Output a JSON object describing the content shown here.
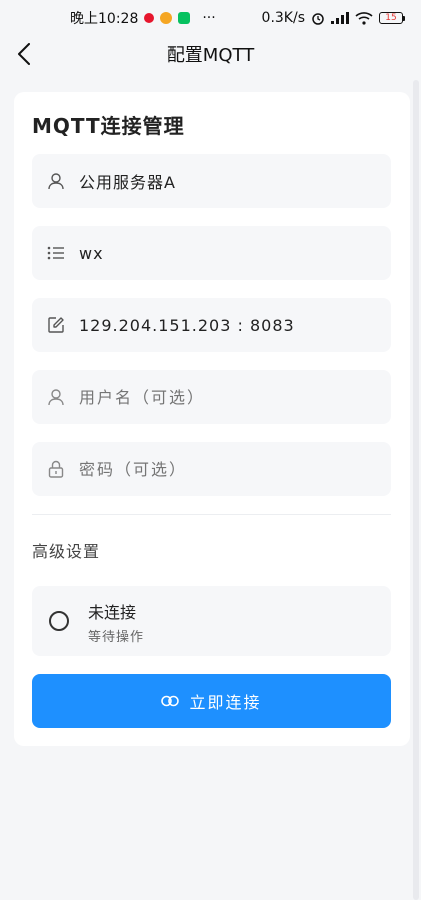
{
  "status_bar": {
    "time": "晚上10:28",
    "dots": "···",
    "net_speed": "0.3K/s",
    "battery": "15"
  },
  "header": {
    "title": "配置MQTT"
  },
  "card": {
    "title": "MQTT连接管理",
    "server_name": "公用服务器A",
    "topic": "wx",
    "address": "129.204.151.203 : 8083",
    "username_placeholder": "用户名（可选）",
    "password_placeholder": "密码（可选）"
  },
  "advanced": {
    "label": "高级设置"
  },
  "connection": {
    "status": "未连接",
    "detail": "等待操作"
  },
  "connect_button": {
    "label": "立即连接"
  },
  "colors": {
    "accent": "#1e90ff",
    "field_bg": "#f6f7f9",
    "page_bg": "#f5f6f8"
  },
  "icons": [
    "back-arrow-icon",
    "user-icon",
    "list-icon",
    "edit-icon",
    "lock-icon",
    "link-icon"
  ]
}
